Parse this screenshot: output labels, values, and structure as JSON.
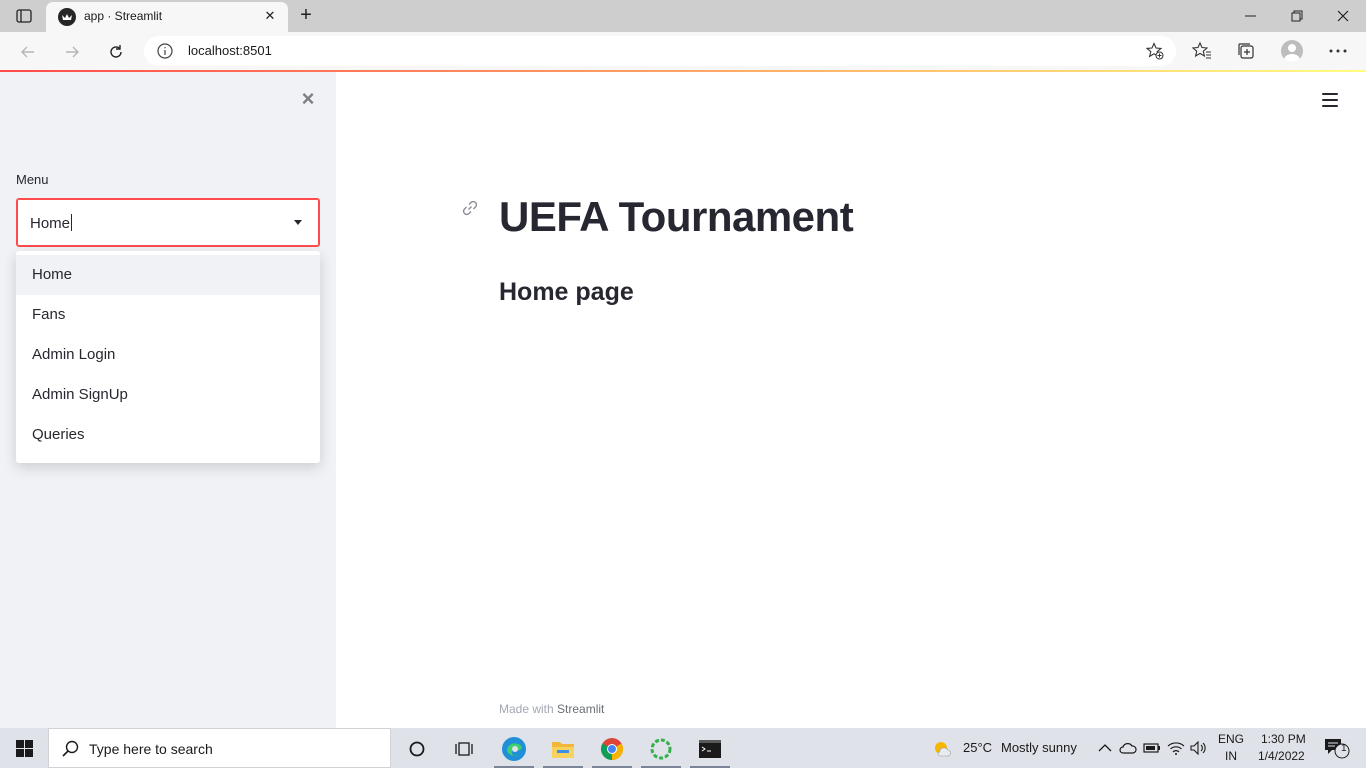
{
  "browser": {
    "tab_title": "app · Streamlit",
    "url": "localhost:8501"
  },
  "sidebar": {
    "menu_label": "Menu",
    "select_value": "Home",
    "options": [
      "Home",
      "Fans",
      "Admin Login",
      "Admin SignUp",
      "Queries"
    ]
  },
  "main": {
    "title": "UEFA Tournament",
    "subtitle": "Home page",
    "footer_prefix": "Made with ",
    "footer_brand": "Streamlit"
  },
  "taskbar": {
    "search_placeholder": "Type here to search",
    "weather_temp": "25°C",
    "weather_desc": "Mostly sunny",
    "lang": "ENG",
    "region": "IN",
    "time": "1:30 PM",
    "date": "1/4/2022",
    "notification_count": "1"
  },
  "colors": {
    "accent": "#ff4b4b",
    "sidebar_bg": "#f0f2f6",
    "text": "#262730"
  }
}
